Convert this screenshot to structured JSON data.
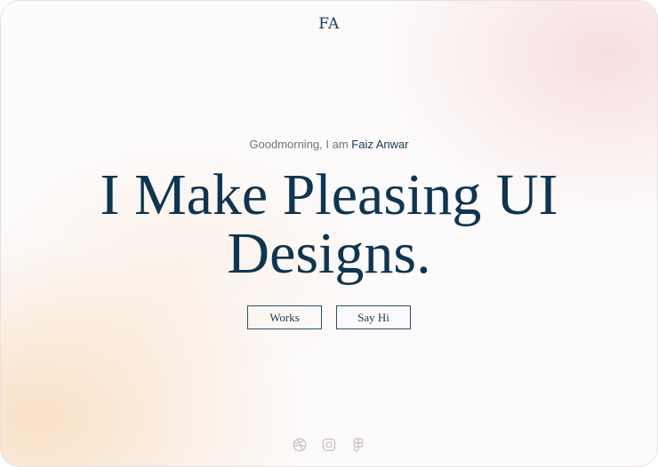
{
  "header": {
    "logo_text": "FA"
  },
  "hero": {
    "greeting_prefix": "Goodmorning, I am ",
    "greeting_name": "Faiz Anwar",
    "headline_line1": "I Make Pleasing UI",
    "headline_line2": "Designs."
  },
  "buttons": {
    "works_label": "Works",
    "say_hi_label": "Say Hi"
  },
  "socials": [
    {
      "icon": "dribbble-icon"
    },
    {
      "icon": "instagram-icon"
    },
    {
      "icon": "figma-icon"
    }
  ],
  "colors": {
    "primary": "#0f3550",
    "muted_text": "#6b7683",
    "icon": "#c9c3c3",
    "background": "#fcfafa"
  }
}
